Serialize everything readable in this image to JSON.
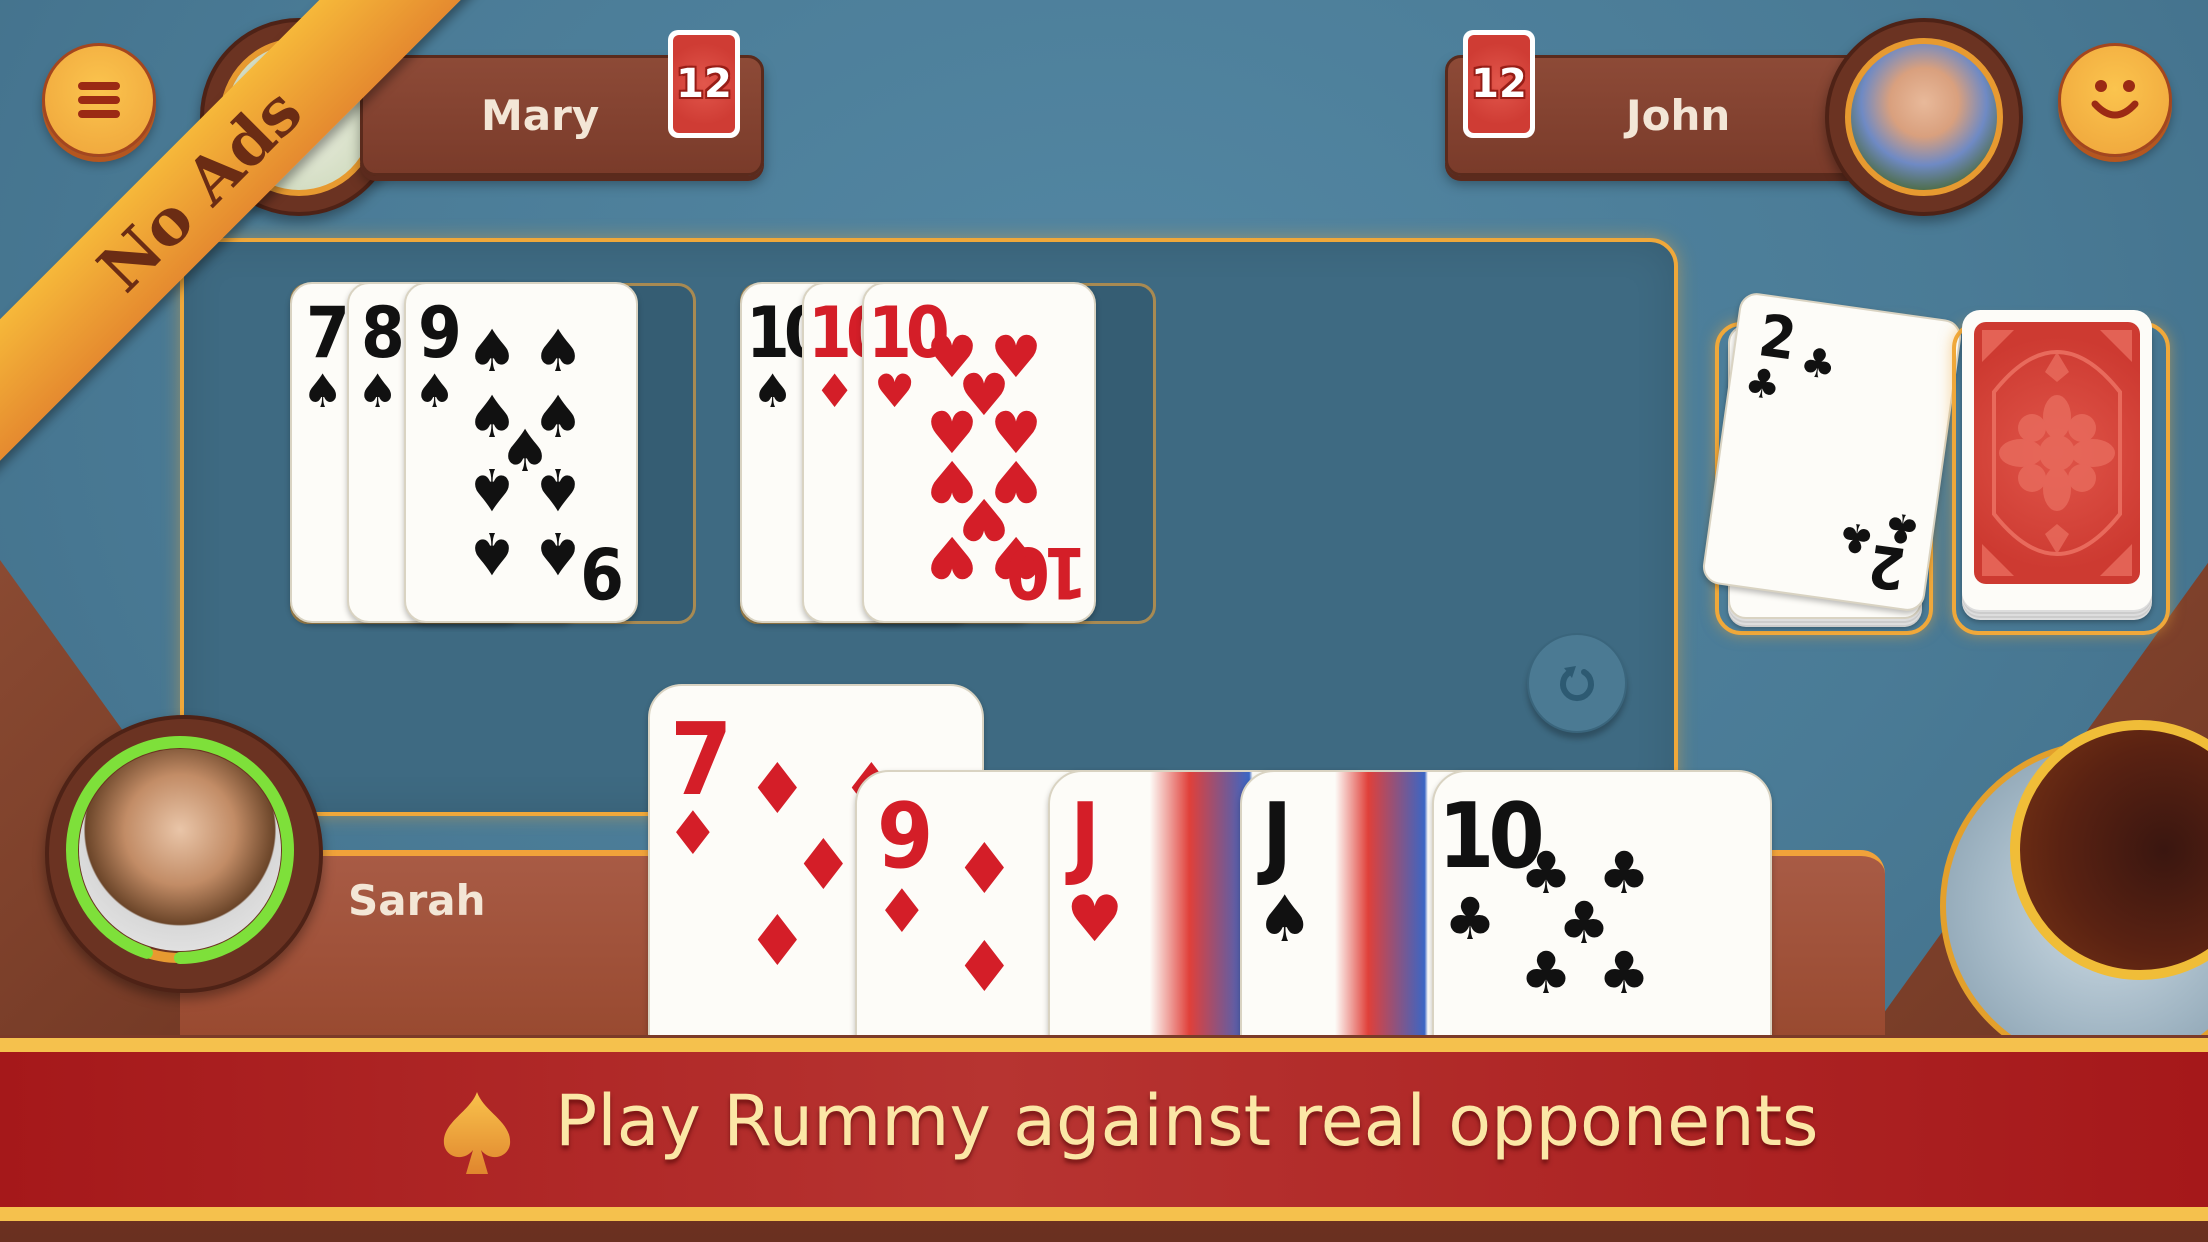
{
  "app": {
    "title": "Rummy"
  },
  "promo": {
    "ribbon_label": "No Ads",
    "banner_text": "Play Rummy against real opponents",
    "banner_icon": "spade-icon"
  },
  "top_bar": {
    "menu_icon": "hamburger-menu-icon",
    "emoji_icon": "smiley-icon"
  },
  "opponents": [
    {
      "name": "Mary",
      "card_count": "12"
    },
    {
      "name": "John",
      "card_count": "12"
    }
  ],
  "player": {
    "name": "Sarah",
    "turn_timer_remaining": 0.95
  },
  "melds": [
    {
      "cards": [
        {
          "rank": "7",
          "suit": "♠",
          "color": "black"
        },
        {
          "rank": "8",
          "suit": "♠",
          "color": "black"
        },
        {
          "rank": "9",
          "suit": "♠",
          "color": "black"
        }
      ]
    },
    {
      "cards": [
        {
          "rank": "10",
          "suit": "♠",
          "color": "black"
        },
        {
          "rank": "10",
          "suit": "♦",
          "color": "red"
        },
        {
          "rank": "10",
          "suit": "♥",
          "color": "red"
        }
      ]
    }
  ],
  "discard_pile": {
    "top_card": {
      "rank": "2",
      "suit": "♣",
      "color": "black"
    }
  },
  "draw_pile": {
    "label": "face-down deck"
  },
  "undo_icon": "undo-icon",
  "hand": [
    {
      "rank": "7",
      "suit": "♦",
      "color": "red"
    },
    {
      "rank": "9",
      "suit": "♦",
      "color": "red"
    },
    {
      "rank": "J",
      "suit": "♥",
      "color": "red"
    },
    {
      "rank": "J",
      "suit": "♠",
      "color": "black"
    },
    {
      "rank": "10",
      "suit": "♣",
      "color": "black"
    }
  ],
  "colors": {
    "felt": "#4a7d98",
    "accent_gold": "#f0a83a",
    "wood": "#8a4a32",
    "banner_red": "#b73431",
    "card_red": "#d41e28"
  }
}
